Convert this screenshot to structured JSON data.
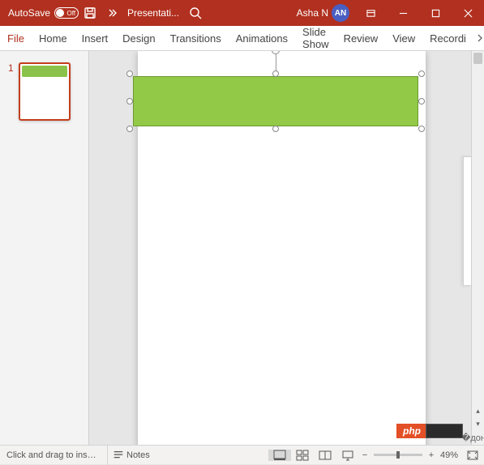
{
  "titlebar": {
    "autosave_label": "AutoSave",
    "autosave_state": "Off",
    "doc_title": "Presentati...",
    "user_name": "Asha N",
    "user_initials": "AN"
  },
  "ribbon": {
    "tabs": {
      "file": "File",
      "home": "Home",
      "insert": "Insert",
      "design": "Design",
      "transitions": "Transitions",
      "animations": "Animations",
      "slideshow": "Slide Show",
      "review": "Review",
      "view": "View",
      "recording": "Recordi"
    }
  },
  "thumbs": {
    "slide1_num": "1"
  },
  "status": {
    "message": "Click and drag to insert...",
    "notes_label": "Notes",
    "zoom_pct": "49%"
  },
  "colors": {
    "brand": "#b1301f",
    "shape": "#92c947"
  },
  "watermark": {
    "text": "php"
  }
}
